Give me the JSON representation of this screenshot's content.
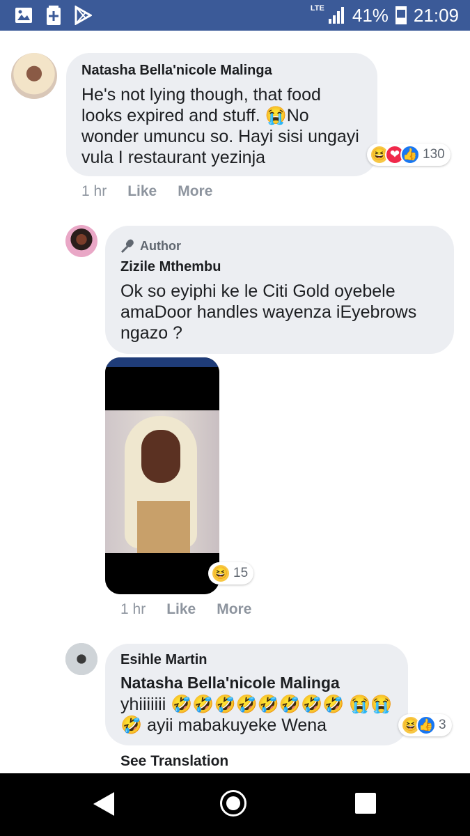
{
  "status_bar": {
    "network": "LTE",
    "battery": "41%",
    "time": "21:09",
    "icons": [
      "gallery-icon",
      "plus-icon",
      "play-store-icon"
    ]
  },
  "comments": [
    {
      "author": "Natasha Bella'nicole Malinga",
      "text": "He's not lying though, that food looks expired and stuff. 😭No wonder umuncu so. Hayi sisi ungayi vula I restaurant yezinja",
      "reactions": {
        "icons": [
          "😆",
          "❤",
          "👍"
        ],
        "count": "130"
      },
      "time": "1 hr",
      "like_label": "Like",
      "more_label": "More"
    },
    {
      "badge": "Author",
      "author": "Zizile Mthembu",
      "text": "Ok so eyiphi ke le Citi Gold oyebele amaDoor handles wayenza iEyebrows ngazo ?",
      "image_reactions": {
        "icons": [
          "😆"
        ],
        "count": "15"
      },
      "time": "1 hr",
      "like_label": "Like",
      "more_label": "More"
    },
    {
      "author": "Esihle Martin",
      "reply_to": "Natasha Bella'nicole Malinga",
      "text": "yhiiiiiii 🤣🤣🤣🤣🤣🤣🤣🤣 😭😭🤣 ayii mabakuyeke Wena",
      "reactions": {
        "icons": [
          "😆",
          "👍"
        ],
        "count": "3"
      },
      "see_translation": "See Translation"
    }
  ]
}
